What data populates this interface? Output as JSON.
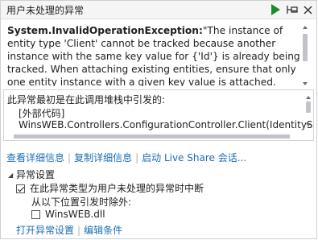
{
  "window": {
    "title": "用户未处理的异常"
  },
  "exception": {
    "type": "System.InvalidOperationException:",
    "message": "\"The instance of entity type 'Client' cannot be tracked because another instance with the same key value for {'Id'} is already being tracked. When attaching existing entities, ensure that only one entity instance with a given key value is attached. Consider using"
  },
  "stack": {
    "title": "此异常最初是在此调用堆栈中引发的:",
    "lines": [
      "[外部代码]",
      "WinsWEB.Controllers.ConfigurationController.Client(IdentitySer"
    ]
  },
  "actions": {
    "view_details": "查看详细信息",
    "copy_details": "复制详细信息",
    "live_share": "启动 Live Share 会话..."
  },
  "exception_settings": {
    "header": "异常设置",
    "break_when_label": "在此异常类型为用户未处理的异常时中断",
    "break_when_checked": true,
    "except_from_label": "从以下位置引发时除外:",
    "module_label": "WinsWEB.dll",
    "module_checked": false
  },
  "footer_links": {
    "open_settings": "打开异常设置",
    "edit_conditions": "编辑条件"
  },
  "colors": {
    "link": "#1a6fb5",
    "continue_icon": "#1e8a2e"
  }
}
